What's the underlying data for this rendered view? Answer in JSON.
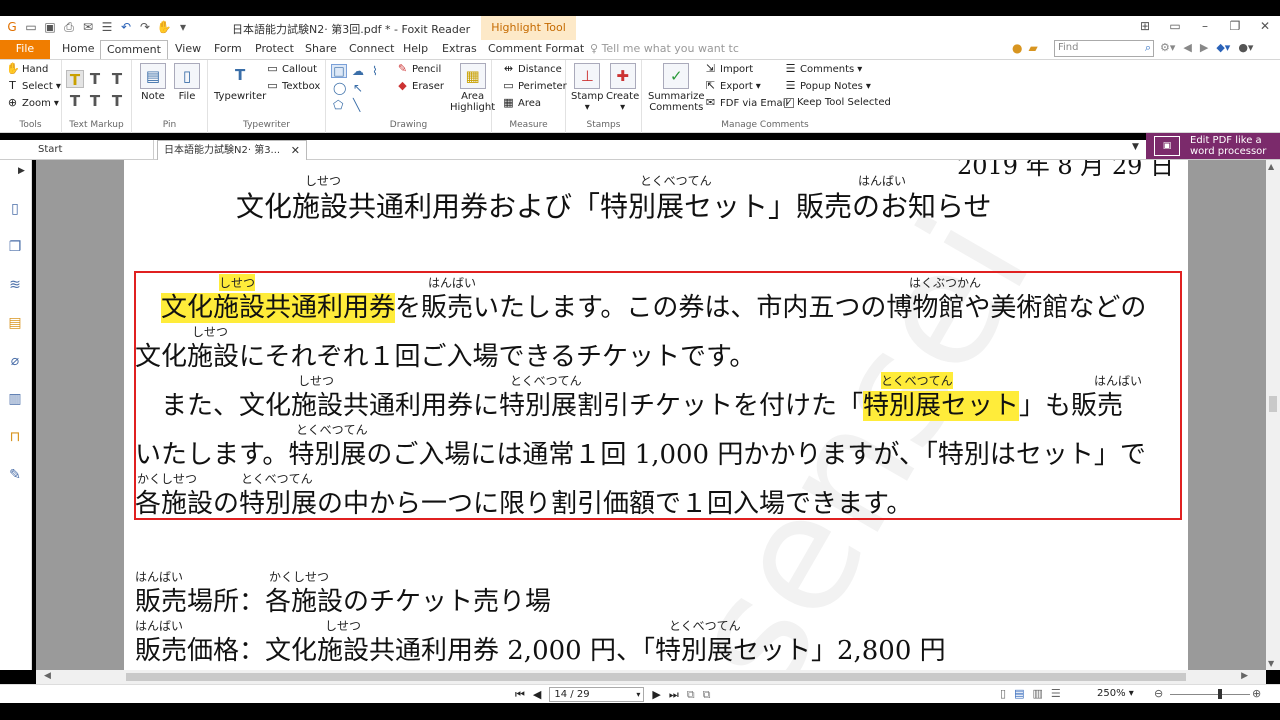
{
  "window": {
    "title": "日本語能力試験N2· 第3回.pdf * - Foxit Reader",
    "context_tab": "Highlight Tool"
  },
  "tabs": [
    "File",
    "Home",
    "Comment",
    "View",
    "Form",
    "Protect",
    "Share",
    "Connect",
    "Help",
    "Extras",
    "Comment Format"
  ],
  "active_tab": "Comment",
  "tell_me": "Tell me what you want tc",
  "find": {
    "placeholder": "Find"
  },
  "ribbon": {
    "tools": {
      "hand": "Hand",
      "select": "Select",
      "zoom": "Zoom",
      "label": "Tools"
    },
    "text_markup": {
      "label": "Text Markup"
    },
    "pin": {
      "note": "Note",
      "file": "File",
      "label": "Pin"
    },
    "typewriter": {
      "typewriter": "Typewriter",
      "callout": "Callout",
      "textbox": "Textbox",
      "label": "Typewriter"
    },
    "drawing": {
      "pencil": "Pencil",
      "eraser": "Eraser",
      "area_highlight_1": "Area",
      "area_highlight_2": "Highlight",
      "label": "Drawing"
    },
    "measure": {
      "distance": "Distance",
      "perimeter": "Perimeter",
      "area": "Area",
      "label": "Measure"
    },
    "stamps": {
      "stamp": "Stamp",
      "create": "Create",
      "label": "Stamps"
    },
    "manage": {
      "summarize_1": "Summarize",
      "summarize_2": "Comments",
      "import": "Import",
      "export": "Export",
      "fdf": "FDF via Email",
      "comments": "Comments",
      "popup": "Popup Notes",
      "keep": "Keep Tool Selected",
      "label": "Manage Comments"
    }
  },
  "doc_tabs": {
    "start": "Start",
    "current": "日本語能力試験N2· 第3..."
  },
  "promo": {
    "line1": "Edit PDF like a",
    "line2": "word processor"
  },
  "document": {
    "date_partial": "2019 年 8 月 29 日",
    "title": "文化施設共通利用券および「特別展セット」販売のお知らせ",
    "title_ruby": {
      "r1": "しせつ",
      "r2": "とくべつてん",
      "r3": "はんばい"
    },
    "p1_hl": "文化施設共通利用券",
    "p1_rest": "を販売いたします。この券は、市内五つの博物館や美術館などの",
    "p1_ruby": {
      "r1": "しせつ",
      "r2": "はんばい",
      "r3": "はくぶつかん"
    },
    "p2": "文化施設にそれぞれ１回ご入場できるチケットです。",
    "p2_ruby": "しせつ",
    "p3_a": "　また、文化施設共通利用券に特別展割引チケットを付けた「",
    "p3_hl": "特別展セット",
    "p3_b": "」も販売",
    "p3_ruby": {
      "r1": "しせつ",
      "r2": "とくべつてん",
      "r3": "とくべつてん",
      "r4": "はんばい"
    },
    "p4": "いたします。特別展のご入場には通常１回 1,000 円かかりますが、「特別はセット」で",
    "p4_ruby": "とくべつてん",
    "p5": "各施設の特別展の中から一つに限り割引価額で１回入場できます。",
    "p5_ruby": {
      "r1": "かくしせつ",
      "r2": "とくべつてん"
    },
    "place": "販売場所：各施設のチケット売り場",
    "place_ruby": {
      "r1": "はんばい",
      "r2": "かくしせつ"
    },
    "price": "販売価格：文化施設共通利用券 2,000 円、「特別展セット」2,800 円",
    "price_ruby": {
      "r1": "はんばい",
      "r2": "しせつ",
      "r3": "とくべつてん"
    }
  },
  "status": {
    "page": "14 / 29",
    "zoom": "250%"
  },
  "colors": {
    "accent": "#f07d00",
    "highlight": "#ffec3a",
    "box": "#e02020",
    "promo": "#7b2a6b"
  }
}
